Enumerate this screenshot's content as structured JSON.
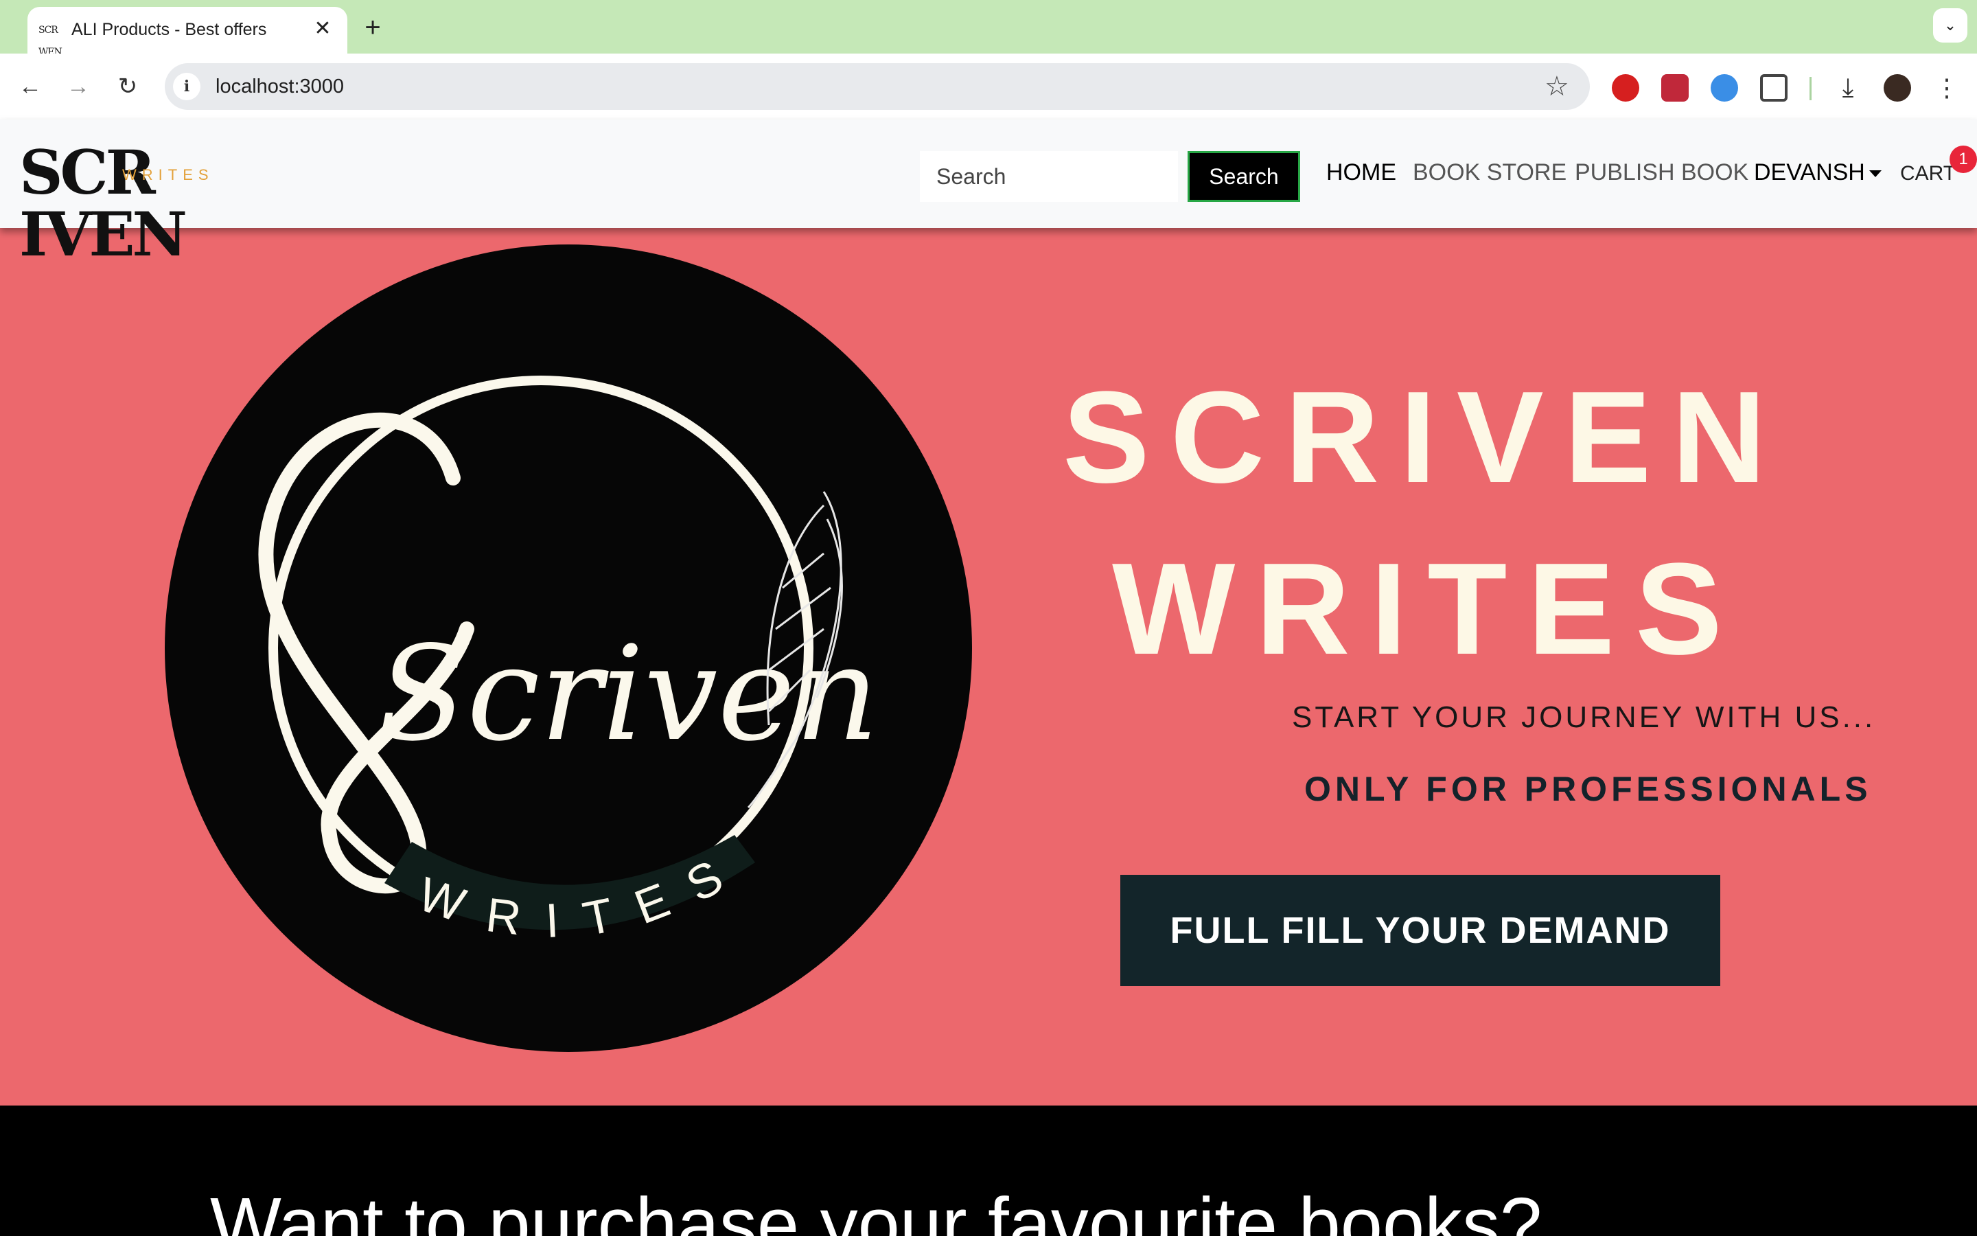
{
  "browser": {
    "tab_title": "ALI Products - Best offers",
    "favicon_text": "SCR WEN",
    "url": "localhost:3000",
    "new_tab_symbol": "+",
    "close_symbol": "✕"
  },
  "nav": {
    "logo_main": "SCR IVEN",
    "logo_sub": "WRITES",
    "search_placeholder": "Search",
    "search_button": "Search",
    "links": [
      "HOME",
      "BOOK STORE",
      "PUBLISH BOOK"
    ],
    "user": "DEVANSH",
    "cart_label": "CART",
    "cart_count": "1"
  },
  "hero": {
    "title_line1": "SCRIVEN",
    "title_line2": "WRITES",
    "subtitle": "START YOUR JOURNEY WITH US...",
    "tagline": "ONLY FOR PROFESSIONALS",
    "cta": "FULL FILL YOUR DEMAND",
    "emblem_script": "Scriven",
    "emblem_ribbon": "WRITES"
  },
  "section2": {
    "title": "Want to purchase your favourite books?"
  },
  "colors": {
    "tabstrip": "#c5e8b7",
    "hero_bg": "#ec686d",
    "hero_text": "#fdf8e6",
    "cta_bg": "#13252a",
    "badge": "#e8253a"
  }
}
